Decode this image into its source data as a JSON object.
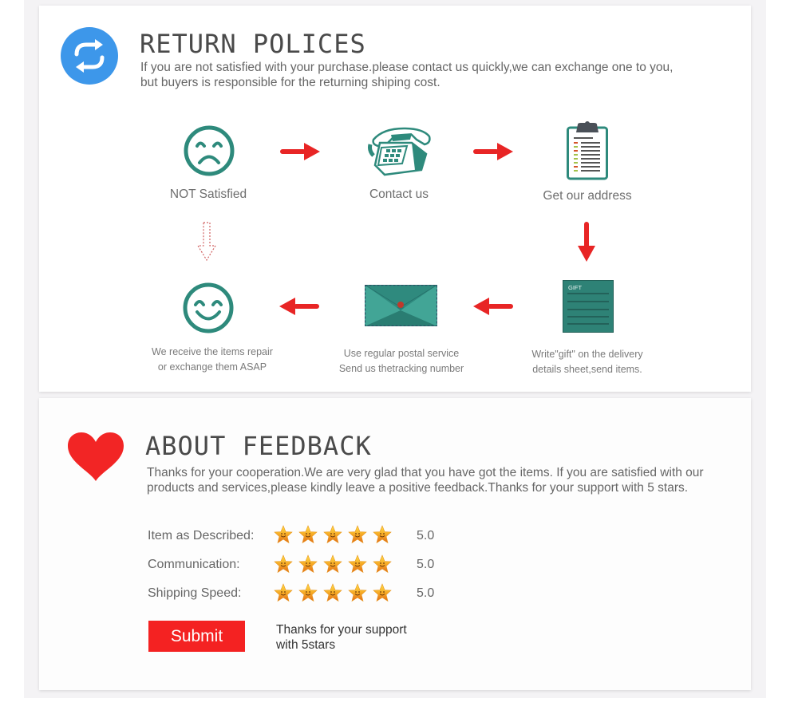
{
  "return_policy": {
    "icon": "refresh-cycle-icon",
    "title": "RETURN POLICES",
    "description_line1": "If you are not satisfied with your purchase.please contact us quickly,we can exchange one to you,",
    "description_line2": "but buyers is responsible for the returning shiping cost.",
    "steps": [
      {
        "icon": "sad-face-icon",
        "label": "NOT Satisfied"
      },
      {
        "icon": "telephone-icon",
        "label": "Contact us"
      },
      {
        "icon": "clipboard-icon",
        "label": "Get our address"
      },
      {
        "icon": "gift-sheet-icon",
        "badge": "GIFT",
        "label_line1": "Write\"gift\" on the delivery",
        "label_line2": "details sheet,send items."
      },
      {
        "icon": "envelope-icon",
        "label_line1": "Use regular postal service",
        "label_line2": "Send us thetracking number"
      },
      {
        "icon": "happy-face-icon",
        "label_line1": "We receive the items repair",
        "label_line2": "or exchange them ASAP"
      }
    ],
    "colors": {
      "accent_teal": "#2e8a7c",
      "arrow_red": "#e82525",
      "icon_blue": "#3d97ea"
    }
  },
  "feedback": {
    "icon": "heart-icon",
    "title": "ABOUT FEEDBACK",
    "description_line1": "Thanks for your cooperation.We are very glad that you have got the items. If you are satisfied with our",
    "description_line2": "products and services,please kindly leave a positive feedback.Thanks for your support with 5 stars.",
    "ratings": [
      {
        "label": "Item as Described:",
        "stars": 5,
        "max_stars": 5,
        "value": "5.0"
      },
      {
        "label": "Communication:",
        "stars": 5,
        "max_stars": 5,
        "value": "5.0"
      },
      {
        "label": "Shipping Speed:",
        "stars": 5,
        "max_stars": 5,
        "value": "5.0"
      }
    ],
    "submit_label": "Submit",
    "support_note_line1": "Thanks for your support",
    "support_note_line2": "with 5stars",
    "colors": {
      "heart_red": "#f22525",
      "submit_red": "#f42222"
    }
  }
}
